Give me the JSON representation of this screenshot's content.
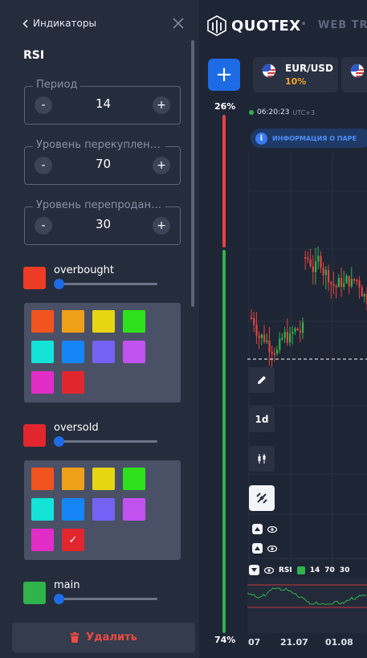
{
  "header": {
    "logo_text": "QUOTEX",
    "web_text": "WEB TRA"
  },
  "panel": {
    "back_label": "Индикаторы",
    "title": "RSI",
    "fields": [
      {
        "label": "Период",
        "value": "14"
      },
      {
        "label": "Уровень перекупленн...",
        "value": "70"
      },
      {
        "label": "Уровень перепроданн...",
        "value": "30"
      }
    ],
    "colors": [
      {
        "label": "overbought",
        "color": "#ee3b24",
        "slider": 0.0
      },
      {
        "label": "oversold",
        "color": "#e2262e",
        "slider": 0.0
      },
      {
        "label": "main",
        "color": "#2fb34b",
        "slider": 0.0
      }
    ],
    "palette": [
      "#f1541e",
      "#f0a018",
      "#e7d514",
      "#2ee11c",
      "#13e3d8",
      "#1585f7",
      "#7462f4",
      "#c253f1",
      "#e22cc7",
      "#e2262e"
    ],
    "palette_selected": [
      null,
      9
    ],
    "check_glyph": "✓",
    "delete_label": "Удалить"
  },
  "trade": {
    "plus_label": "+",
    "pair": {
      "name": "EUR/USD",
      "percent": "10%"
    },
    "pct_top": "26%",
    "pct_bottom": "74%",
    "sentiment_up_fraction": 0.74,
    "time": "06:20:23",
    "timezone": "UTC+3",
    "info_icon": "i",
    "info_label": "ИНФОРМАЦИЯ О ПАРЕ",
    "timeframe": "1d",
    "rsi": {
      "label": "RSI",
      "period": "14",
      "overbought": "70",
      "oversold": "30"
    },
    "dates": [
      "07",
      "21.07",
      "01.08"
    ]
  },
  "colors": {
    "accent": "#1e6be6",
    "up": "#2fb34b",
    "down": "#e5443e",
    "warning": "#f0a420"
  }
}
